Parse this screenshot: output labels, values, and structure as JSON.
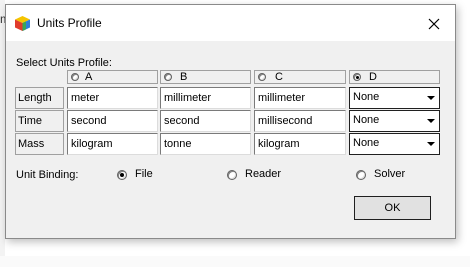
{
  "window": {
    "title": "Units Profile",
    "icon": "cube-logo-icon",
    "close_icon": "close-icon"
  },
  "section_label": "Select Units Profile:",
  "profiles": [
    {
      "label": "A",
      "selected": false
    },
    {
      "label": "B",
      "selected": false
    },
    {
      "label": "C",
      "selected": false
    },
    {
      "label": "D",
      "selected": true
    }
  ],
  "rows": [
    {
      "label": "Length",
      "values": [
        "meter",
        "millimeter",
        "millimeter"
      ],
      "d_value": "None"
    },
    {
      "label": "Time",
      "values": [
        "second",
        "second",
        "millisecond"
      ],
      "d_value": "None"
    },
    {
      "label": "Mass",
      "values": [
        "kilogram",
        "tonne",
        "kilogram"
      ],
      "d_value": "None"
    }
  ],
  "binding": {
    "label": "Unit Binding:",
    "options": [
      {
        "label": "File",
        "selected": true
      },
      {
        "label": "Reader",
        "selected": false
      },
      {
        "label": "Solver",
        "selected": false
      }
    ]
  },
  "ok_label": "OK",
  "background_fragment": "m"
}
